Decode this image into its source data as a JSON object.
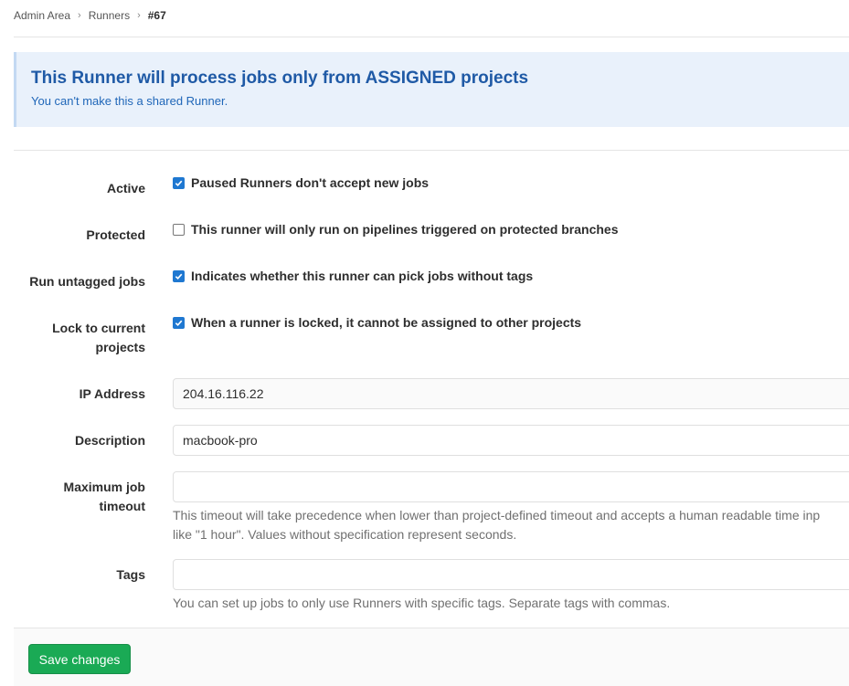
{
  "breadcrumb": {
    "items": [
      "Admin Area",
      "Runners"
    ],
    "current": "#67"
  },
  "alert": {
    "title": "This Runner will process jobs only from ASSIGNED projects",
    "subtitle": "You can't make this a shared Runner."
  },
  "form": {
    "active": {
      "label": "Active",
      "checked": true,
      "text": "Paused Runners don't accept new jobs"
    },
    "protected": {
      "label": "Protected",
      "checked": false,
      "text": "This runner will only run on pipelines triggered on protected branches"
    },
    "run_untagged": {
      "label": "Run untagged jobs",
      "checked": true,
      "text": "Indicates whether this runner can pick jobs without tags"
    },
    "locked": {
      "label_line1": "Lock to current",
      "label_line2": "projects",
      "checked": true,
      "text": "When a runner is locked, it cannot be assigned to other projects"
    },
    "ip_address": {
      "label": "IP Address",
      "value": "204.16.116.22"
    },
    "description": {
      "label": "Description",
      "value": "macbook-pro"
    },
    "max_timeout": {
      "label_line1": "Maximum job",
      "label_line2": "timeout",
      "value": "",
      "help_line1": "This timeout will take precedence when lower than project-defined timeout and accepts a human readable time inp",
      "help_line2": "like \"1 hour\". Values without specification represent seconds."
    },
    "tags": {
      "label": "Tags",
      "value": "",
      "help": "You can set up jobs to only use Runners with specific tags. Separate tags with commas."
    }
  },
  "footer": {
    "save_label": "Save changes"
  },
  "colors": {
    "primary": "#1f78d1",
    "success": "#1aaa55",
    "alert_bg": "#e9f1fb",
    "alert_title": "#1f5aa6"
  }
}
